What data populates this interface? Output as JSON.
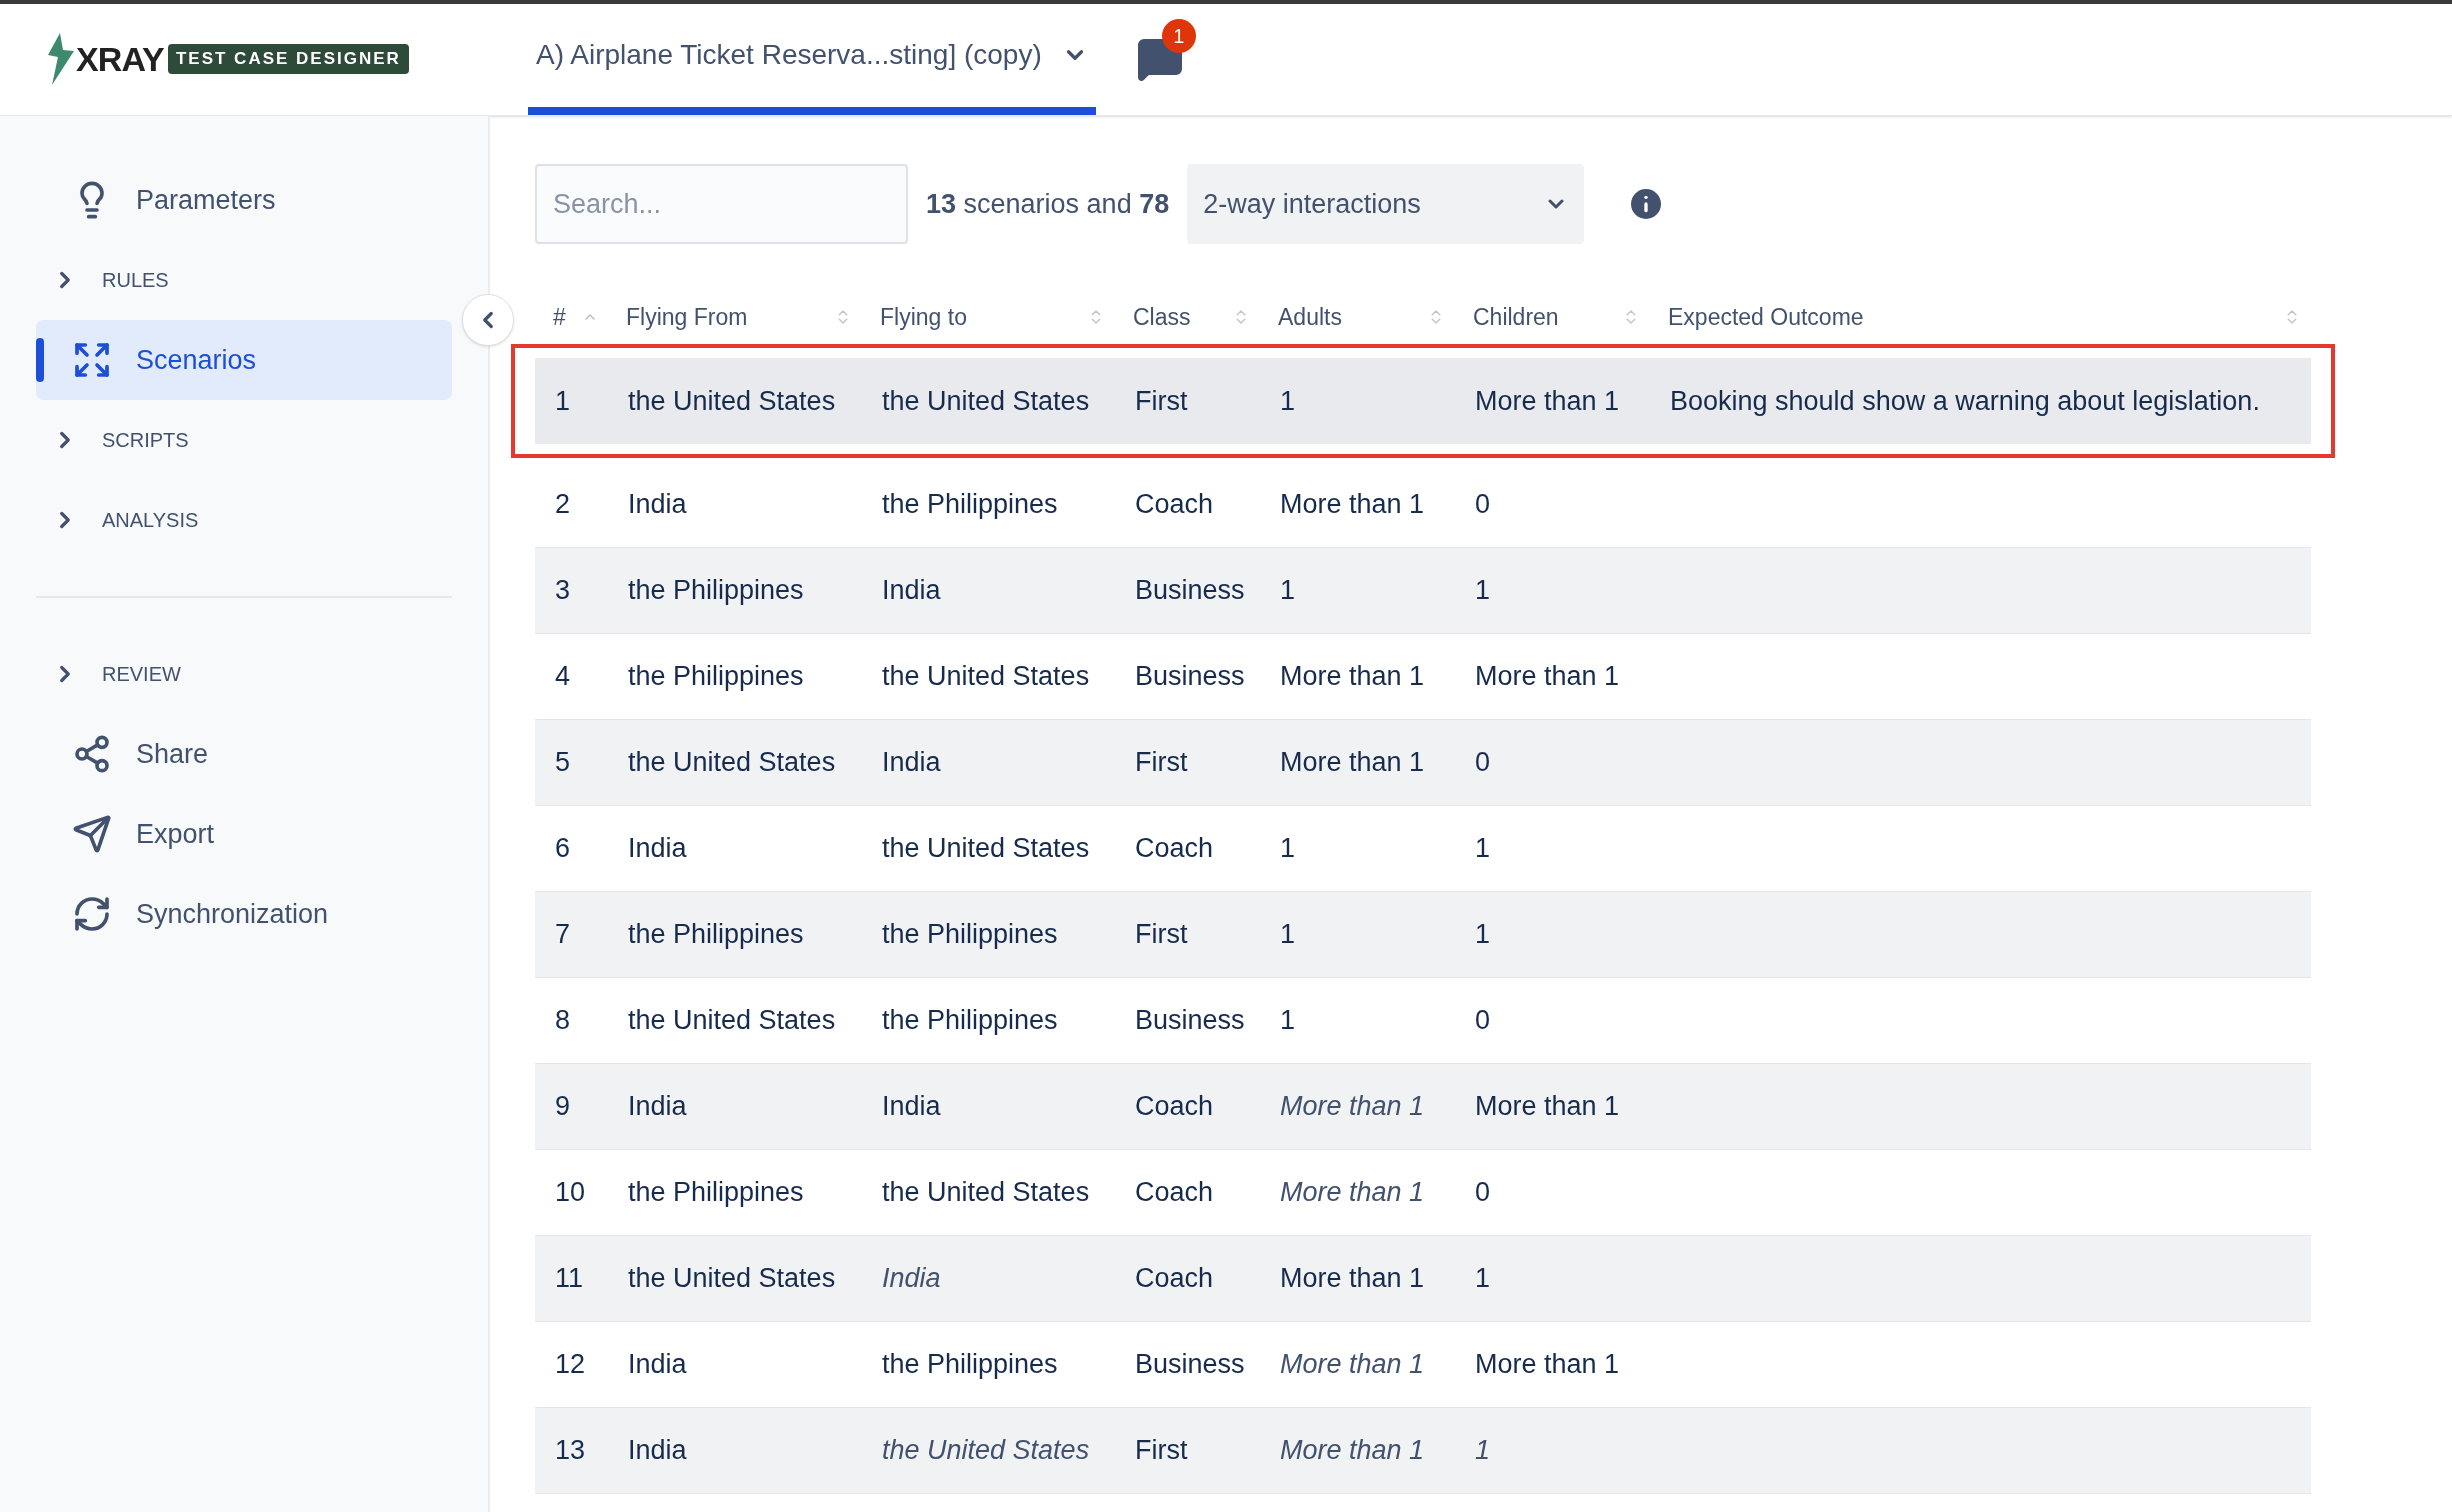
{
  "header": {
    "logo_text": "XRAY",
    "logo_badge": "TEST CASE DESIGNER",
    "tabs": [
      {
        "label": "A) Airplane Ticket Reserva...sting] (copy)",
        "selected": true
      }
    ],
    "notification_count": "1"
  },
  "sidebar": {
    "groups": [
      [
        {
          "kind": "link",
          "label": "Parameters",
          "selected": false
        },
        {
          "kind": "section",
          "label": "RULES",
          "selected": false
        },
        {
          "kind": "link",
          "label": "Scenarios",
          "selected": true
        },
        {
          "kind": "section",
          "label": "SCRIPTS",
          "selected": false
        },
        {
          "kind": "section",
          "label": "ANALYSIS",
          "selected": false
        }
      ],
      [
        {
          "kind": "section",
          "label": "REVIEW",
          "selected": false
        },
        {
          "kind": "link",
          "label": "Share",
          "selected": false
        },
        {
          "kind": "link",
          "label": "Export",
          "selected": false
        },
        {
          "kind": "link",
          "label": "Synchronization",
          "selected": false
        }
      ]
    ]
  },
  "toolbar": {
    "search": {
      "placeholder": "Search..."
    },
    "summary": "**13** scenarios and **78**",
    "interactions": {
      "value": "2-way interactions"
    }
  },
  "table": {
    "columns": [
      "#",
      "Flying From",
      "Flying to",
      "Class",
      "Adults",
      "Children",
      "Expected Outcome"
    ],
    "rows": [
      {
        "highlighted": true,
        "cells": [
          {
            "text": "1",
            "italic": false
          },
          {
            "text": "the United States",
            "italic": false
          },
          {
            "text": "the United States",
            "italic": false
          },
          {
            "text": "First",
            "italic": false
          },
          {
            "text": "1",
            "italic": false
          },
          {
            "text": "More than 1",
            "italic": false
          },
          {
            "text": "Booking should show a warning about legislation.",
            "italic": false
          }
        ]
      },
      {
        "highlighted": false,
        "cells": [
          {
            "text": "2",
            "italic": false
          },
          {
            "text": "India",
            "italic": false
          },
          {
            "text": "the Philippines",
            "italic": false
          },
          {
            "text": "Coach",
            "italic": false
          },
          {
            "text": "More than 1",
            "italic": false
          },
          {
            "text": "0",
            "italic": false
          }
        ]
      },
      {
        "highlighted": false,
        "cells": [
          {
            "text": "3",
            "italic": false
          },
          {
            "text": "the Philippines",
            "italic": false
          },
          {
            "text": "India",
            "italic": false
          },
          {
            "text": "Business",
            "italic": false
          },
          {
            "text": "1",
            "italic": false
          },
          {
            "text": "1",
            "italic": false
          }
        ]
      },
      {
        "highlighted": false,
        "cells": [
          {
            "text": "4",
            "italic": false
          },
          {
            "text": "the Philippines",
            "italic": false
          },
          {
            "text": "the United States",
            "italic": false
          },
          {
            "text": "Business",
            "italic": false
          },
          {
            "text": "More than 1",
            "italic": false
          },
          {
            "text": "More than 1",
            "italic": false
          }
        ]
      },
      {
        "highlighted": false,
        "cells": [
          {
            "text": "5",
            "italic": false
          },
          {
            "text": "the United States",
            "italic": false
          },
          {
            "text": "India",
            "italic": false
          },
          {
            "text": "First",
            "italic": false
          },
          {
            "text": "More than 1",
            "italic": false
          },
          {
            "text": "0",
            "italic": false
          }
        ]
      },
      {
        "highlighted": false,
        "cells": [
          {
            "text": "6",
            "italic": false
          },
          {
            "text": "India",
            "italic": false
          },
          {
            "text": "the United States",
            "italic": false
          },
          {
            "text": "Coach",
            "italic": false
          },
          {
            "text": "1",
            "italic": false
          },
          {
            "text": "1",
            "italic": false
          }
        ]
      },
      {
        "highlighted": false,
        "cells": [
          {
            "text": "7",
            "italic": false
          },
          {
            "text": "the Philippines",
            "italic": false
          },
          {
            "text": "the Philippines",
            "italic": false
          },
          {
            "text": "First",
            "italic": false
          },
          {
            "text": "1",
            "italic": false
          },
          {
            "text": "1",
            "italic": false
          }
        ]
      },
      {
        "highlighted": false,
        "cells": [
          {
            "text": "8",
            "italic": false
          },
          {
            "text": "the United States",
            "italic": false
          },
          {
            "text": "the Philippines",
            "italic": false
          },
          {
            "text": "Business",
            "italic": false
          },
          {
            "text": "1",
            "italic": false
          },
          {
            "text": "0",
            "italic": false
          }
        ]
      },
      {
        "highlighted": false,
        "cells": [
          {
            "text": "9",
            "italic": false
          },
          {
            "text": "India",
            "italic": false
          },
          {
            "text": "India",
            "italic": false
          },
          {
            "text": "Coach",
            "italic": false
          },
          {
            "text": "More than 1",
            "italic": true
          },
          {
            "text": "More than 1",
            "italic": false
          }
        ]
      },
      {
        "highlighted": false,
        "cells": [
          {
            "text": "10",
            "italic": false
          },
          {
            "text": "the Philippines",
            "italic": false
          },
          {
            "text": "the United States",
            "italic": false
          },
          {
            "text": "Coach",
            "italic": false
          },
          {
            "text": "More than 1",
            "italic": true
          },
          {
            "text": "0",
            "italic": false
          }
        ]
      },
      {
        "highlighted": false,
        "cells": [
          {
            "text": "11",
            "italic": false
          },
          {
            "text": "the United States",
            "italic": false
          },
          {
            "text": "India",
            "italic": true
          },
          {
            "text": "Coach",
            "italic": false
          },
          {
            "text": "More than 1",
            "italic": false
          },
          {
            "text": "1",
            "italic": false
          }
        ]
      },
      {
        "highlighted": false,
        "cells": [
          {
            "text": "12",
            "italic": false
          },
          {
            "text": "India",
            "italic": false
          },
          {
            "text": "the Philippines",
            "italic": false
          },
          {
            "text": "Business",
            "italic": false
          },
          {
            "text": "More than 1",
            "italic": true
          },
          {
            "text": "More than 1",
            "italic": false
          }
        ]
      },
      {
        "highlighted": false,
        "cells": [
          {
            "text": "13",
            "italic": false
          },
          {
            "text": "India",
            "italic": false
          },
          {
            "text": "the United States",
            "italic": true
          },
          {
            "text": "First",
            "italic": false
          },
          {
            "text": "More than 1",
            "italic": true
          },
          {
            "text": "1",
            "italic": true
          }
        ]
      }
    ]
  }
}
